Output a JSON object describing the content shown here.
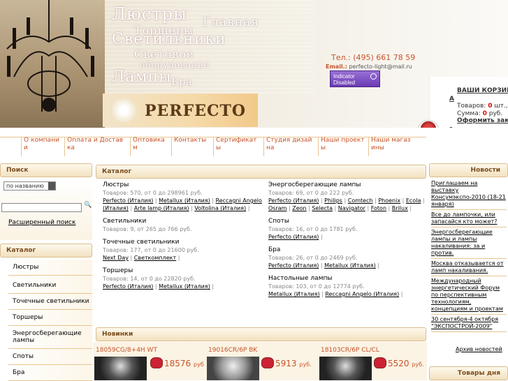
{
  "header": {
    "titles": [
      "Люстры",
      "Торшеры",
      "Светильники",
      "Световое",
      "оборудование",
      "Лампы",
      "Бра",
      "Главная"
    ],
    "logo": "PERFECTO",
    "phone_label": "Тел.:",
    "phone": "(495) 661 78 59",
    "email_label": "Email.:",
    "email": "perfecto-light@mail.ru",
    "indicator_line1": "Indicator",
    "indicator_line2": "Disabled"
  },
  "cart": {
    "title": "ВАШИ КОРЗИН",
    "marker": "А",
    "items_label": "Товаров:",
    "items_value": "0",
    "items_unit": "шт.,",
    "sum_label": "Сумма:",
    "sum_value": "0",
    "sum_unit": "руб.",
    "checkout": "Оформить зака",
    "bottom_marker": "з"
  },
  "nav": [
    "О компании",
    "Оплата и Доставка",
    "Оптовика м",
    "Контакты",
    "Сертификат ы",
    "Студия дизайна",
    "Наши проекты",
    "Наши магазины"
  ],
  "search": {
    "heading": "Поиск",
    "mode": "по названию",
    "button": "🔍",
    "advanced": "Расширенный поиск"
  },
  "left_catalog": {
    "heading": "Каталог",
    "items": [
      "Люстры",
      "Светильники",
      "Точечные светильники",
      "Торшеры",
      "Энергосберегающие лампы",
      "Споты",
      "Бра"
    ]
  },
  "catalog": {
    "heading": "Каталог",
    "left": [
      {
        "name": "Люстры",
        "count": "Товаров: 570, от 0 до 298961 руб.",
        "links": [
          "Perfecto (Италия)",
          "Metallux (Италия)",
          "Reccagni Angelo (Италия)",
          "Arte lamp (Италия)",
          "Voltolina (Италия)"
        ]
      },
      {
        "name": "Светильники",
        "count": "Товаров: 9, от 265 до 766 руб.",
        "links": []
      },
      {
        "name": "Точечные светильники",
        "count": "Товаров: 177, от 0 до 21600 руб.",
        "links": [
          "Next Day",
          "Светкомплект"
        ]
      },
      {
        "name": "Торшеры",
        "count": "Товаров: 14, от 0 до 22820 руб.",
        "links": [
          "Perfecto (Италия)",
          "Metallux (Италия)"
        ]
      }
    ],
    "right": [
      {
        "name": "Энергосберегающие лампы",
        "count": "Товаров: 69, от 0 до 222 руб.",
        "links": [
          "Perfecto (Италия)",
          "Philips",
          "Comtech",
          "Phoenix",
          "Ecola",
          "Osram",
          "Zeon",
          "Selecta",
          "Navigator",
          "Foton",
          "Brilux"
        ]
      },
      {
        "name": "Споты",
        "count": "Товаров: 16, от 0 до 1781 руб.",
        "links": [
          "Perfecto (Италия)"
        ]
      },
      {
        "name": "Бра",
        "count": "Товаров: 26, от 0 до 2469 руб.",
        "links": [
          "Perfecto (Италия)",
          "Metallux (Италия)"
        ]
      },
      {
        "name": "Настольные лампы",
        "count": "Товаров: 103, от 0 до 12774 руб.",
        "links": [
          "Metallux (Италия)",
          "Reccagni Angelo (Италия)"
        ]
      }
    ]
  },
  "novinki": {
    "heading": "Новинки",
    "products": [
      {
        "name": "18059CG/8+4H WT",
        "price": "18576",
        "unit": "руб"
      },
      {
        "name": "19016CR/6P BK",
        "price": "5913",
        "unit": "руб."
      },
      {
        "name": "18103CR/6P CL/CL",
        "price": "5520",
        "unit": "руб."
      }
    ]
  },
  "news": {
    "heading": "Новости",
    "items": [
      "Приглашаем на выставку Консумэкспо-2010 (18-21 января)",
      "Все до лампочки, или запасайся кто может?",
      "Энергосберегающие лампы и лампы накаливания: за и против.",
      "Москва отказывается от ламп накаливания.",
      "Международный энергетический Форум по перспективным технологиям, концепциям и проектам",
      "30 сентября-4 октября \"ЭКСПОСТРОЙ-2009\""
    ],
    "archive": "Архив новостей",
    "day_heading": "Товары дня"
  },
  "colors": {
    "accent": "#c7542a",
    "panel_border": "#d9bd8d",
    "panel_text": "#7a4c1c",
    "indicator": "#6a3bb4"
  }
}
